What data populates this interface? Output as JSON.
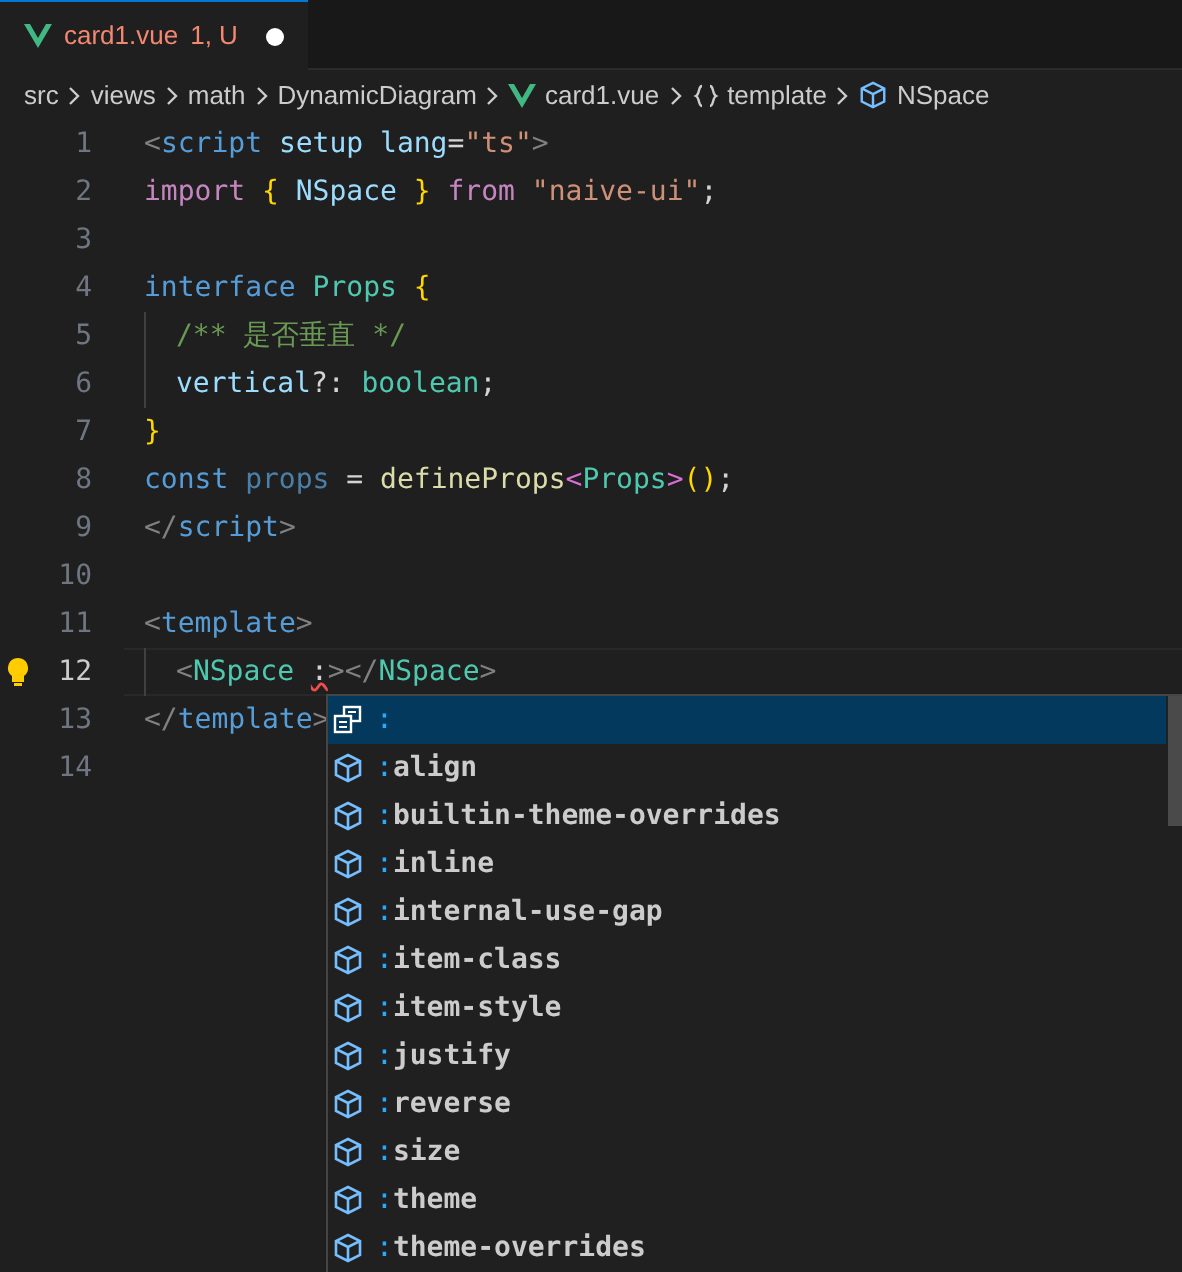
{
  "tabs": [
    {
      "title": "card1.vue",
      "badge": "1, U",
      "modified": true,
      "selected": true
    }
  ],
  "breadcrumbs": [
    {
      "kind": "text",
      "label": "src"
    },
    {
      "kind": "text",
      "label": "views"
    },
    {
      "kind": "text",
      "label": "math"
    },
    {
      "kind": "text",
      "label": "DynamicDiagram"
    },
    {
      "kind": "vue",
      "label": "card1.vue"
    },
    {
      "kind": "braces",
      "label": "template"
    },
    {
      "kind": "component",
      "label": "NSpace"
    }
  ],
  "lines": [
    {
      "number": "1",
      "current": false,
      "tokens": [
        {
          "t": "<",
          "color": "#808080"
        },
        {
          "t": "script ",
          "color": "#569cd6"
        },
        {
          "t": "setup lang",
          "color": "#9cdcfe"
        },
        {
          "t": "=",
          "color": "#d4d4d4"
        },
        {
          "t": "\"ts\"",
          "color": "#ce9178"
        },
        {
          "t": ">",
          "color": "#808080"
        }
      ]
    },
    {
      "number": "2",
      "current": false,
      "tokens": [
        {
          "t": "import ",
          "color": "#c586c0"
        },
        {
          "t": "{",
          "color": "#ffd700"
        },
        {
          "t": " NSpace ",
          "color": "#9cdcfe"
        },
        {
          "t": "}",
          "color": "#ffd700"
        },
        {
          "t": " from ",
          "color": "#c586c0"
        },
        {
          "t": "\"naive-ui\"",
          "color": "#ce9178"
        },
        {
          "t": ";",
          "color": "#d4d4d4"
        }
      ]
    },
    {
      "number": "3",
      "current": false
    },
    {
      "number": "4",
      "current": false,
      "tokens": [
        {
          "t": "interface ",
          "color": "#569cd6"
        },
        {
          "t": "Props ",
          "color": "#4ec9b0"
        },
        {
          "t": "{",
          "color": "#ffd700"
        }
      ]
    },
    {
      "number": "5",
      "current": false,
      "indent": true,
      "tokens": [
        {
          "t": "/** 是否垂直 */",
          "color": "#6a9955"
        }
      ]
    },
    {
      "number": "6",
      "current": false,
      "indent": true,
      "tokens": [
        {
          "t": "vertical",
          "color": "#9cdcfe"
        },
        {
          "t": "?: ",
          "color": "#d4d4d4"
        },
        {
          "t": "boolean",
          "color": "#4ec9b0"
        },
        {
          "t": ";",
          "color": "#d4d4d4"
        }
      ]
    },
    {
      "number": "7",
      "current": false,
      "tokens": [
        {
          "t": "}",
          "color": "#ffd700"
        }
      ]
    },
    {
      "number": "8",
      "current": false,
      "tokens": [
        {
          "t": "const ",
          "color": "#569cd6"
        },
        {
          "t": "props",
          "color": "#4a7fa8"
        },
        {
          "t": " = ",
          "color": "#d4d4d4"
        },
        {
          "t": "defineProps",
          "color": "#dcdcaa"
        },
        {
          "t": "<",
          "color": "#da70d6"
        },
        {
          "t": "Props",
          "color": "#4ec9b0"
        },
        {
          "t": ">",
          "color": "#da70d6"
        },
        {
          "t": "()",
          "color": "#ffd700"
        },
        {
          "t": ";",
          "color": "#d4d4d4"
        }
      ]
    },
    {
      "number": "9",
      "current": false,
      "tokens": [
        {
          "t": "</",
          "color": "#808080"
        },
        {
          "t": "script",
          "color": "#569cd6"
        },
        {
          "t": ">",
          "color": "#808080"
        }
      ]
    },
    {
      "number": "10",
      "current": false
    },
    {
      "number": "11",
      "current": false,
      "tokens": [
        {
          "t": "<",
          "color": "#808080"
        },
        {
          "t": "template",
          "color": "#569cd6"
        },
        {
          "t": ">",
          "color": "#808080"
        }
      ]
    },
    {
      "number": "12",
      "current": true,
      "indent": true,
      "lightbulb": true,
      "tokens": [
        {
          "t": "<",
          "color": "#808080"
        },
        {
          "t": "NSpace ",
          "color": "#4ec9b0"
        },
        {
          "t": ":",
          "color": "#d4d4d4",
          "error": true
        },
        {
          "t": "></",
          "color": "#808080"
        },
        {
          "t": "NSpace",
          "color": "#4ec9b0"
        },
        {
          "t": ">",
          "color": "#808080"
        }
      ]
    },
    {
      "number": "13",
      "current": false,
      "tokens": [
        {
          "t": "</",
          "color": "#808080"
        },
        {
          "t": "template",
          "color": "#569cd6"
        },
        {
          "t": ">",
          "color": "#808080"
        }
      ]
    },
    {
      "number": "14",
      "current": false
    }
  ],
  "suggestions": [
    {
      "kind": "snippet",
      "label": ":",
      "selected": true
    },
    {
      "kind": "property",
      "label": ":align",
      "selected": false
    },
    {
      "kind": "property",
      "label": ":builtin-theme-overrides",
      "selected": false
    },
    {
      "kind": "property",
      "label": ":inline",
      "selected": false
    },
    {
      "kind": "property",
      "label": ":internal-use-gap",
      "selected": false
    },
    {
      "kind": "property",
      "label": ":item-class",
      "selected": false
    },
    {
      "kind": "property",
      "label": ":item-style",
      "selected": false
    },
    {
      "kind": "property",
      "label": ":justify",
      "selected": false
    },
    {
      "kind": "property",
      "label": ":reverse",
      "selected": false
    },
    {
      "kind": "property",
      "label": ":size",
      "selected": false
    },
    {
      "kind": "property",
      "label": ":theme",
      "selected": false
    },
    {
      "kind": "property",
      "label": ":theme-overrides",
      "selected": false
    }
  ]
}
